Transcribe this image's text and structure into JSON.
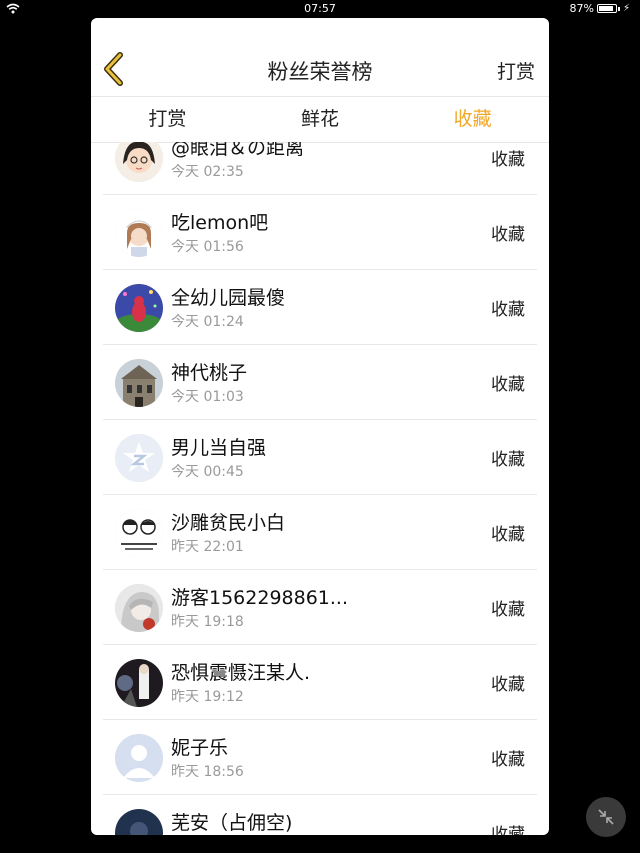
{
  "status_bar": {
    "time": "07:57",
    "battery": "87%",
    "battery_level": 0.87
  },
  "header": {
    "title": "粉丝荣誉榜",
    "right_label": "打赏"
  },
  "tabs": [
    {
      "label": "打赏"
    },
    {
      "label": "鲜花"
    },
    {
      "label": "收藏"
    }
  ],
  "active_tab": "收藏",
  "accent_color": "#f0a828",
  "rows": [
    {
      "name": "@眼泪＆の距离",
      "time": "今天 02:35",
      "action": "收藏",
      "avatar_icon": "cartoon-girl-avatar"
    },
    {
      "name": "吃lemon吧",
      "time": "今天 01:56",
      "action": "收藏",
      "avatar_icon": "nurse-girl-avatar"
    },
    {
      "name": "全幼儿园最傻",
      "time": "今天 01:24",
      "action": "收藏",
      "avatar_icon": "teletubby-avatar"
    },
    {
      "name": "神代桃子",
      "time": "今天 01:03",
      "action": "收藏",
      "avatar_icon": "building-avatar"
    },
    {
      "name": "男儿当自强",
      "time": "今天 00:45",
      "action": "收藏",
      "avatar_icon": "default-star-avatar"
    },
    {
      "name": "沙雕贫民小白",
      "time": "昨天 22:01",
      "action": "收藏",
      "avatar_icon": "sketch-avatar"
    },
    {
      "name": "游客1562298861...",
      "time": "昨天 19:18",
      "action": "收藏",
      "avatar_icon": "anime-avatar"
    },
    {
      "name": "恐惧震慑汪某人.",
      "time": "昨天 19:12",
      "action": "收藏",
      "avatar_icon": "stage-avatar"
    },
    {
      "name": "妮子乐",
      "time": "昨天 18:56",
      "action": "收藏",
      "avatar_icon": "default-person-avatar"
    },
    {
      "name": "芜安（占佣空)",
      "time": "",
      "action": "收藏",
      "avatar_icon": "dark-avatar"
    }
  ]
}
